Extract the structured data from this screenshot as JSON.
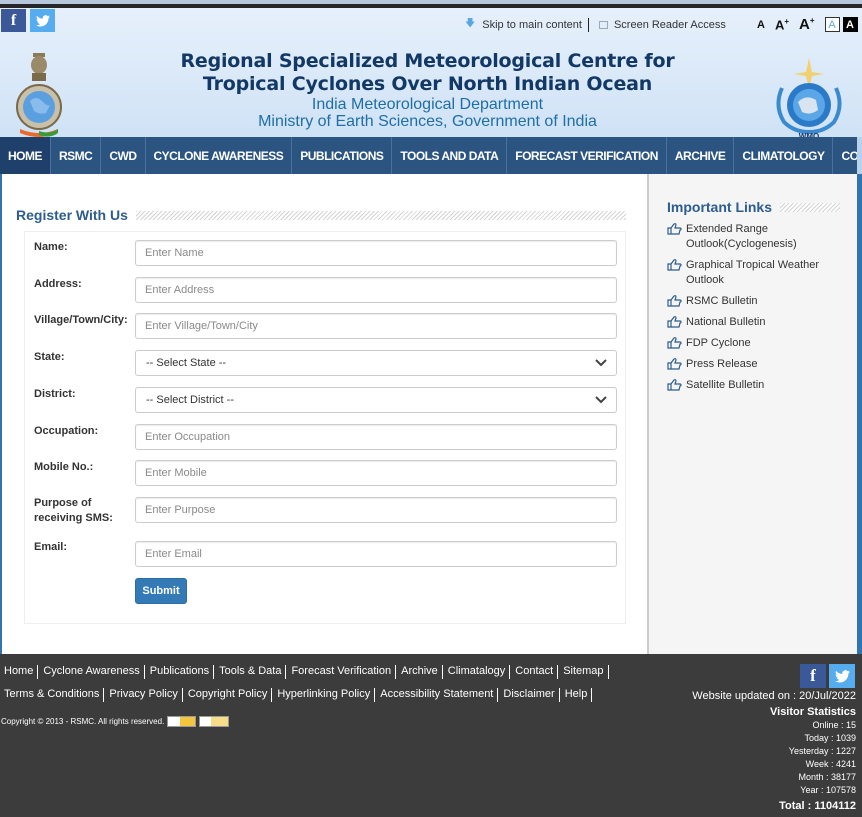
{
  "header": {
    "social": {
      "facebook": "f",
      "twitter": "🐦"
    },
    "skip_link": "Skip to main content",
    "screen_reader_link": "Screen Reader Access",
    "font_controls": {
      "normal": "A",
      "large": "A",
      "larger": "A",
      "plus": "+",
      "contrast_light": "A",
      "contrast_dark": "A"
    },
    "title_line1": "Regional Specialized Meteorological Centre for",
    "title_line2": "Tropical Cyclones Over North Indian Ocean",
    "subtitle_line1": "India Meteorological Department",
    "subtitle_line2": "Ministry of Earth Sciences, Government of India",
    "wmo_label": "WMO"
  },
  "nav": {
    "items": [
      {
        "label": "HOME",
        "active": true
      },
      {
        "label": "RSMC"
      },
      {
        "label": "CWD"
      },
      {
        "label": "CYCLONE AWARENESS"
      },
      {
        "label": "PUBLICATIONS"
      },
      {
        "label": "TOOLS AND DATA"
      },
      {
        "label": "FORECAST VERIFICATION"
      },
      {
        "label": "ARCHIVE"
      },
      {
        "label": "CLIMATOLOGY"
      },
      {
        "label": "CONTACT"
      }
    ]
  },
  "form": {
    "title": "Register With Us",
    "fields": [
      {
        "label": "Name:",
        "placeholder": "Enter Name"
      },
      {
        "label": "Address:",
        "placeholder": "Enter Address"
      },
      {
        "label": "Village/Town/City:",
        "placeholder": "Enter Village/Town/City"
      },
      {
        "label": "State:",
        "selected": "-- Select State --"
      },
      {
        "label": "District:",
        "selected": "-- Select District --"
      },
      {
        "label": "Occupation:",
        "placeholder": "Enter Occupation"
      },
      {
        "label": "Mobile No.:",
        "placeholder": "Enter Mobile"
      },
      {
        "label_line1": "Purpose of",
        "label_line2": "receiving SMS:",
        "placeholder": "Enter Purpose"
      },
      {
        "label": "Email:",
        "placeholder": "Enter Email"
      }
    ],
    "submit_label": "Submit"
  },
  "sidebar": {
    "title": "Important Links",
    "links": [
      {
        "line1": "Extended Range",
        "line2": "Outlook(Cyclogenesis)"
      },
      {
        "line1": "Graphical Tropical Weather",
        "line2": "Outlook"
      },
      {
        "line1": "RSMC Bulletin"
      },
      {
        "line1": "National Bulletin"
      },
      {
        "line1": "FDP Cyclone"
      },
      {
        "line1": "Press Release"
      },
      {
        "line1": "Satellite Bulletin"
      }
    ]
  },
  "footer": {
    "links_row1": [
      "Home",
      "Cyclone Awareness",
      "Publications",
      "Tools & Data",
      "Forecast Verification",
      "Archive",
      "Climatalogy",
      "Contact",
      "Sitemap"
    ],
    "links_row2": [
      "Terms & Conditions",
      "Privacy Policy",
      "Copyright Policy",
      "Hyperlinking Policy",
      "Accessibility Statement",
      "Disclaimer",
      "Help"
    ],
    "copyright": "Copyright © 2013 - RSMC. All rights reserved.",
    "badges": [
      "W3C XHTML 1.0",
      "W3C CSS"
    ],
    "social": {
      "facebook": "f",
      "twitter": "🐦"
    },
    "updated": "Website updated on : 20/Jul/2022",
    "visitor_title": "Visitor Statistics",
    "stats": {
      "online": "Online : 15",
      "today": "Today : 1039",
      "yesterday": "Yesterday : 1227",
      "week": "Week : 4241",
      "month": "Month : 38177",
      "year": "Year : 107578",
      "total": "Total : 1104112"
    }
  },
  "colors": {
    "nav_bg": "#2b5580",
    "nav_active": "#1e406a",
    "title": "#123866",
    "subtitle": "#1f6ea8",
    "section_title": "#2d5d8e",
    "submit": "#337ab7",
    "footer_bg": "#3c3c3c"
  }
}
